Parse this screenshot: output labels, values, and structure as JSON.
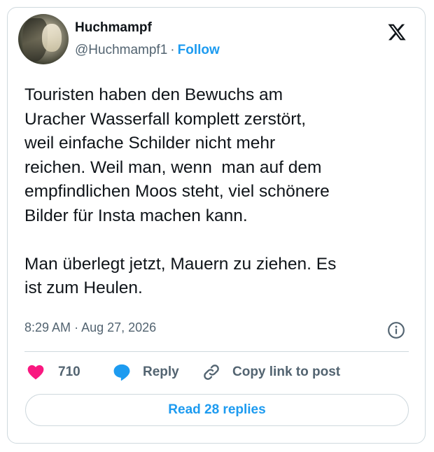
{
  "author": {
    "name": "Huchmampf",
    "handle": "@Huchmampf1",
    "separator": "·",
    "follow_label": "Follow"
  },
  "tweet": {
    "text": "Touristen haben den Bewuchs am\nUracher Wasserfall komplett zerstört,\nweil einfache Schilder nicht mehr\nreichen. Weil man, wenn  man auf dem\nempfindlichen Moos steht, viel schönere\nBilder für Insta machen kann.\n\nMan überlegt jetzt, Mauern zu ziehen. Es\nist zum Heulen.",
    "time": "8:29 AM",
    "separator": "·",
    "date": "Aug 27, 2026"
  },
  "actions": {
    "like_count": "710",
    "reply_label": "Reply",
    "copy_link_label": "Copy link to post"
  },
  "read_replies_label": "Read 28 replies",
  "icons": {
    "logo": "x-logo-icon",
    "info": "info-icon",
    "like": "heart-icon",
    "reply": "speech-bubble-icon",
    "copy": "link-icon"
  },
  "colors": {
    "accent": "#1d9bf0",
    "like": "#f91880",
    "text": "#0f1419",
    "muted": "#536471",
    "border": "#cfd9de"
  }
}
